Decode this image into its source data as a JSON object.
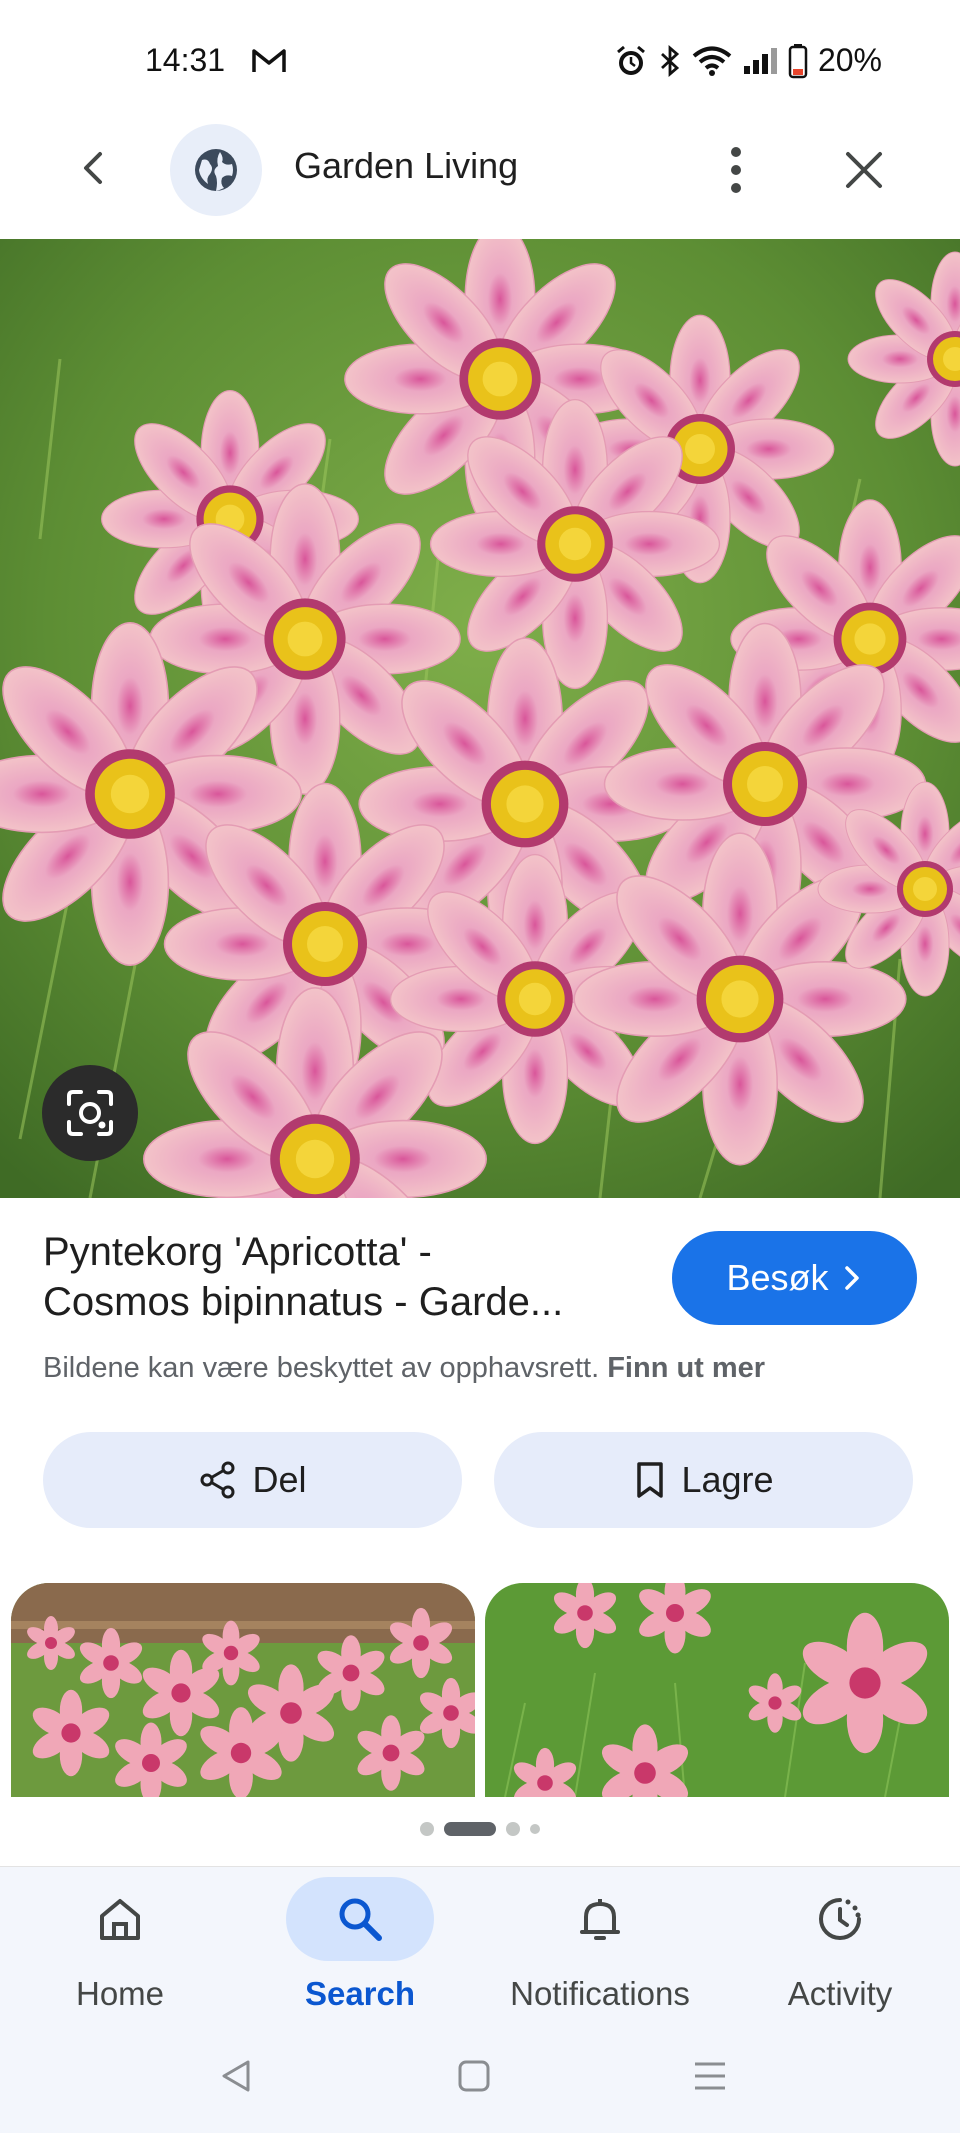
{
  "status_bar": {
    "time": "14:31",
    "battery": "20%",
    "icons": [
      "gmail-icon",
      "alarm-icon",
      "bluetooth-icon",
      "wifi-icon",
      "signal-icon",
      "battery-icon"
    ]
  },
  "header": {
    "title": "Garden Living",
    "icons": [
      "back-arrow-icon",
      "globe-icon",
      "more-vert-icon",
      "close-icon"
    ]
  },
  "result": {
    "title_line1": "Pyntekorg 'Apricotta' -",
    "title_line2": "Cosmos bipinnatus - Garde...",
    "visit_label": "Besøk",
    "copyright_text": "Bildene kan være beskyttet av opphavsrett.",
    "copyright_link": "Finn ut mer"
  },
  "actions": {
    "share_label": "Del",
    "save_label": "Lagre"
  },
  "bottom_nav": {
    "items": [
      {
        "label": "Home",
        "icon": "home-icon"
      },
      {
        "label": "Search",
        "icon": "search-icon",
        "active": true
      },
      {
        "label": "Notifications",
        "icon": "bell-icon"
      },
      {
        "label": "Activity",
        "icon": "activity-icon"
      }
    ]
  },
  "colors": {
    "accent": "#1a73e8",
    "pill_bg": "#e6ecfa",
    "nav_bg": "#f3f6fc",
    "active_nav": "#0b57d0"
  }
}
